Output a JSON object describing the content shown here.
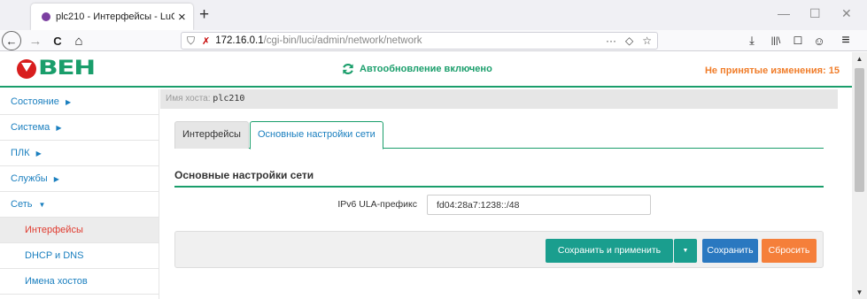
{
  "browser": {
    "tab_title": "plc210 - Интерфейсы - LuCI",
    "tab_close": "×",
    "new_tab": "+",
    "url_prefix": "172.16.0.1",
    "url_path": "/cgi-bin/luci/admin/network/network",
    "win_min": "—",
    "win_max": "☐",
    "win_close": "✕",
    "back": "←",
    "forward": "→",
    "reload": "C",
    "home": "⌂",
    "more": "···",
    "download": "⤓",
    "library": "|||\\",
    "reader": "☐",
    "account": "☺",
    "menu": "≡"
  },
  "header": {
    "logo_text": "ВЕН",
    "autorefresh_label": "Автообновление включено",
    "unsaved_label": "Не принятые изменения: 15",
    "accent_color": "#1a9e6b",
    "warn_color": "#f07d2a"
  },
  "sidebar": {
    "items": [
      {
        "label": "Состояние",
        "caret": "▶"
      },
      {
        "label": "Система",
        "caret": "▶"
      },
      {
        "label": "ПЛК",
        "caret": "▶"
      },
      {
        "label": "Службы",
        "caret": "▶"
      },
      {
        "label": "Сеть",
        "caret": "▼"
      }
    ],
    "subitems": [
      {
        "label": "Интерфейсы"
      },
      {
        "label": "DHCP и DNS"
      },
      {
        "label": "Имена хостов"
      }
    ]
  },
  "main": {
    "hostname_label": "Имя хоста:",
    "hostname_value": "plc210",
    "tabs": [
      {
        "label": "Интерфейсы"
      },
      {
        "label": "Основные настройки сети"
      }
    ],
    "section_title": "Основные настройки сети",
    "ula_label": "IPv6 ULA-префикс",
    "ula_value": "fd04:28a7:1238::/48",
    "buttons": {
      "apply": "Сохранить и применить",
      "apply_dropdown": "▼",
      "save": "Сохранить",
      "reset": "Сбросить"
    }
  }
}
